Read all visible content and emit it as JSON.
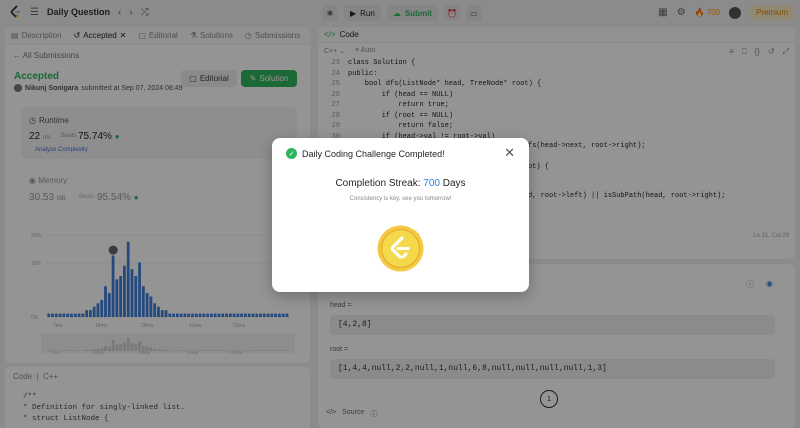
{
  "topbar": {
    "problem_title": "Daily Question",
    "run_label": "Run",
    "submit_label": "Submit",
    "streak_count": "700",
    "premium_label": "Premium"
  },
  "left": {
    "tabs": [
      {
        "label": "Description"
      },
      {
        "label": "Accepted"
      },
      {
        "label": "Editorial"
      },
      {
        "label": "Solutions"
      },
      {
        "label": "Submissions"
      }
    ],
    "all_submissions": "All Submissions",
    "status": "Accepted",
    "submitter": "Nikunj Sonigara",
    "submitted_text": "submitted at Sep 07, 2024 08:49",
    "editorial_btn": "Editorial",
    "solution_btn": "Solution",
    "runtime": {
      "label": "Runtime",
      "value": "22",
      "unit": "ms",
      "beats_label": "Beats",
      "percent": "75.74%",
      "analyze": "Analyze Complexity"
    },
    "memory": {
      "label": "Memory",
      "value": "30.53",
      "unit": "MB",
      "beats_label": "Beats",
      "percent": "95.54%"
    },
    "code_footer": {
      "label": "Code",
      "lang": "C++",
      "lines": [
        "/**",
        " * Definition for singly-linked list.",
        " * struct ListNode {"
      ]
    }
  },
  "chart_data": {
    "type": "bar",
    "title": "",
    "yticks": [
      "20%",
      "10%",
      "0%"
    ],
    "xticks": [
      "7ms",
      "18ms",
      "28ms",
      "41ms",
      "52ms"
    ],
    "values": [
      1,
      1,
      1,
      1,
      1,
      1,
      1,
      1,
      1,
      1,
      2,
      2,
      3,
      4,
      5,
      9,
      7,
      19,
      11,
      12,
      15,
      22,
      14,
      12,
      16,
      9,
      7,
      6,
      4,
      3,
      2,
      2,
      1,
      1,
      1,
      1,
      1,
      1,
      1,
      1,
      1,
      1,
      1,
      1,
      1,
      1,
      1,
      1,
      1,
      1,
      1,
      1,
      1,
      1,
      1,
      1,
      1,
      1,
      1,
      1,
      1,
      1,
      1,
      1
    ],
    "highlight_index": 17,
    "ylim": [
      0,
      24
    ],
    "accent": "#3d7edb"
  },
  "right": {
    "code_tab": "Code",
    "lang": "C++",
    "autosave": "Auto",
    "code_lines": [
      {
        "n": "23",
        "t": "class Solution {"
      },
      {
        "n": "24",
        "t": "public:"
      },
      {
        "n": "25",
        "t": "    bool dfs(ListNode* head, TreeNode* root) {"
      },
      {
        "n": "26",
        "t": "        if (head == NULL)"
      },
      {
        "n": "27",
        "t": "            return true;"
      },
      {
        "n": "28",
        "t": "        if (root == NULL)"
      },
      {
        "n": "29",
        "t": "            return false;"
      },
      {
        "n": "30",
        "t": "        if (head->val != root->val)"
      }
    ],
    "partial_lines": [
      "fs(head->next, root->right);",
      "ot) {",
      "d, root->left) || isSubPath(head, root->right);"
    ],
    "cursor": "Ln 31, Col 29"
  },
  "testcase": {
    "head_label": "head =",
    "head_value": "[4,2,8]",
    "root_label": "root =",
    "root_value": "[1,4,4,null,2,2,null,1,null,6,8,null,null,null,null,1,3]",
    "page": "1",
    "source_label": "Source"
  },
  "modal": {
    "title": "Daily Coding Challenge Completed!",
    "streak_prefix": "Completion Streak:",
    "streak_num": "700",
    "streak_suffix": "Days",
    "subtitle": "Consistency is key, see you tomorrow!"
  }
}
